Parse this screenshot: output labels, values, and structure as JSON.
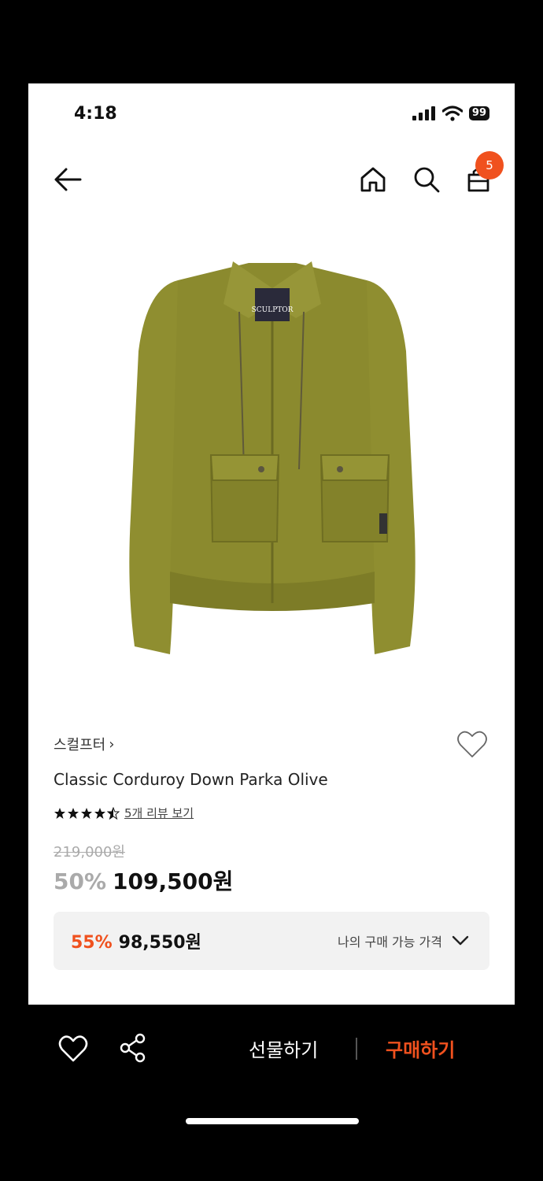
{
  "status": {
    "time": "4:18",
    "battery": "99"
  },
  "nav": {
    "cart_count": "5"
  },
  "product": {
    "brand": "스컬프터",
    "brand_arrow": "›",
    "name": "Classic Corduroy Down Parka Olive",
    "rating": 4.5,
    "review_link": "5개 리뷰 보기",
    "original_price": "219,000원",
    "discount": "50%",
    "sale_price": "109,500원",
    "image_label": "SCULPTOR",
    "member_discount": "55%",
    "member_price": "98,550원",
    "member_price_label": "나의 구매 가능 가격"
  },
  "bottom_bar": {
    "gift_label": "선물하기",
    "buy_label": "구매하기"
  },
  "colors": {
    "accent": "#f0511e",
    "jacket": "#8b8a2e"
  }
}
